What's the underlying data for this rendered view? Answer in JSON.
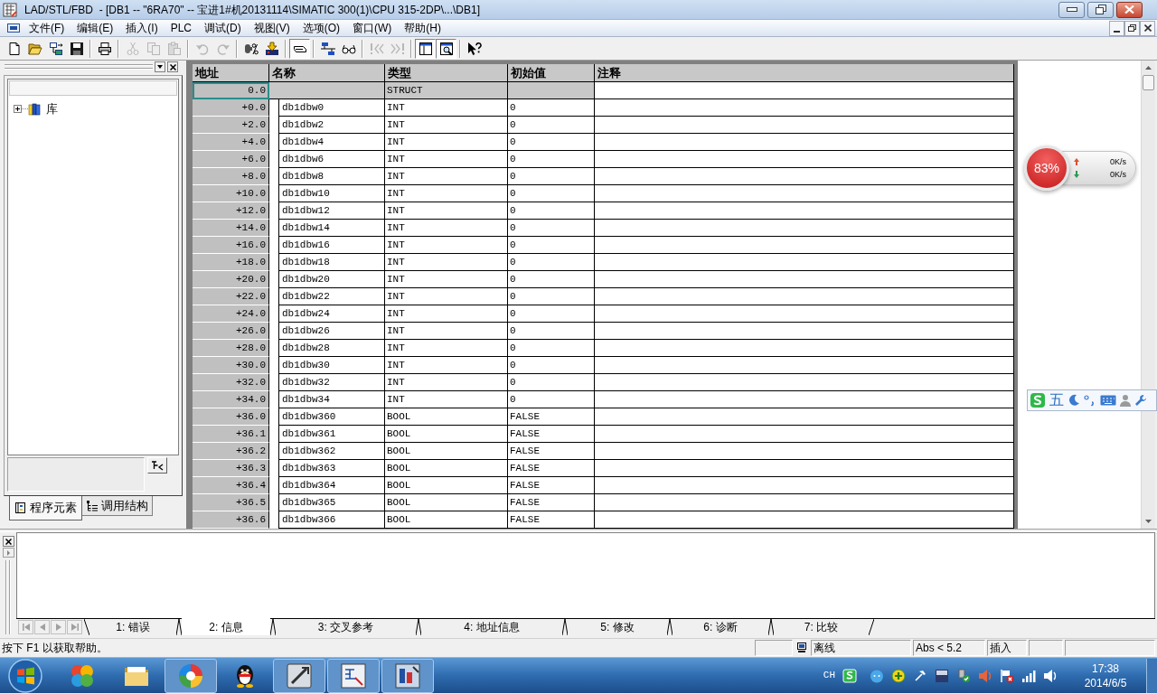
{
  "window": {
    "title": "LAD/STL/FBD  - [DB1 -- \"6RA70\" -- 宝进1#机20131114\\SIMATIC 300(1)\\CPU 315-2DP\\...\\DB1]"
  },
  "menu_bar": {
    "items": [
      "文件(F)",
      "编辑(E)",
      "插入(I)",
      "PLC",
      "调试(D)",
      "视图(V)",
      "选项(O)",
      "窗口(W)",
      "帮助(H)"
    ]
  },
  "toolbar": {
    "groups": [
      [
        {
          "kind": "new",
          "disabled": false,
          "pressed": false
        },
        {
          "kind": "open",
          "disabled": false,
          "pressed": false
        },
        {
          "kind": "nodes",
          "disabled": false,
          "pressed": false
        },
        {
          "kind": "save",
          "disabled": false,
          "pressed": false
        }
      ],
      [
        {
          "kind": "print",
          "disabled": false,
          "pressed": false
        }
      ],
      [
        {
          "kind": "cut",
          "disabled": true,
          "pressed": false
        },
        {
          "kind": "copy",
          "disabled": true,
          "pressed": false
        },
        {
          "kind": "paste",
          "disabled": true,
          "pressed": false
        }
      ],
      [
        {
          "kind": "undo",
          "disabled": true,
          "pressed": false
        },
        {
          "kind": "redo",
          "disabled": true,
          "pressed": false
        }
      ],
      [
        {
          "kind": "compile",
          "disabled": false,
          "pressed": false
        },
        {
          "kind": "download",
          "disabled": false,
          "pressed": false
        }
      ],
      [
        {
          "kind": "overview",
          "disabled": false,
          "pressed": true
        }
      ],
      [
        {
          "kind": "online",
          "disabled": false,
          "pressed": false
        },
        {
          "kind": "monitor",
          "disabled": false,
          "pressed": false
        }
      ],
      [
        {
          "kind": "previous",
          "disabled": true,
          "pressed": false
        },
        {
          "kind": "next",
          "disabled": true,
          "pressed": false
        }
      ],
      [
        {
          "kind": "panes",
          "disabled": false,
          "pressed": true
        },
        {
          "kind": "details",
          "disabled": false,
          "pressed": true
        }
      ],
      [
        {
          "kind": "help",
          "disabled": false,
          "pressed": false
        }
      ]
    ]
  },
  "program_elements": {
    "tree": [
      {
        "label": "库",
        "expanded": false
      }
    ],
    "tabs": [
      {
        "label": "程序元素",
        "selected": true
      },
      {
        "label": "调用结构",
        "selected": false
      }
    ]
  },
  "table": {
    "columns": [
      "地址",
      "名称",
      "类型",
      "初始值",
      "注释"
    ],
    "rows": [
      {
        "kind": "struct",
        "address": "0.0",
        "type": "STRUCT",
        "selected": true
      },
      {
        "kind": "element",
        "address": "+0.0",
        "name": "db1dbw0",
        "type": "INT",
        "initial_value": "0",
        "selected": false
      },
      {
        "kind": "element",
        "address": "+2.0",
        "name": "db1dbw2",
        "type": "INT",
        "initial_value": "0",
        "selected": false
      },
      {
        "kind": "element",
        "address": "+4.0",
        "name": "db1dbw4",
        "type": "INT",
        "initial_value": "0",
        "selected": false
      },
      {
        "kind": "element",
        "address": "+6.0",
        "name": "db1dbw6",
        "type": "INT",
        "initial_value": "0",
        "selected": false
      },
      {
        "kind": "element",
        "address": "+8.0",
        "name": "db1dbw8",
        "type": "INT",
        "initial_value": "0",
        "selected": false
      },
      {
        "kind": "element",
        "address": "+10.0",
        "name": "db1dbw10",
        "type": "INT",
        "initial_value": "0",
        "selected": false
      },
      {
        "kind": "element",
        "address": "+12.0",
        "name": "db1dbw12",
        "type": "INT",
        "initial_value": "0",
        "selected": false
      },
      {
        "kind": "element",
        "address": "+14.0",
        "name": "db1dbw14",
        "type": "INT",
        "initial_value": "0",
        "selected": false
      },
      {
        "kind": "element",
        "address": "+16.0",
        "name": "db1dbw16",
        "type": "INT",
        "initial_value": "0",
        "selected": false
      },
      {
        "kind": "element",
        "address": "+18.0",
        "name": "db1dbw18",
        "type": "INT",
        "initial_value": "0",
        "selected": false
      },
      {
        "kind": "element",
        "address": "+20.0",
        "name": "db1dbw20",
        "type": "INT",
        "initial_value": "0",
        "selected": false
      },
      {
        "kind": "element",
        "address": "+22.0",
        "name": "db1dbw22",
        "type": "INT",
        "initial_value": "0",
        "selected": false
      },
      {
        "kind": "element",
        "address": "+24.0",
        "name": "db1dbw24",
        "type": "INT",
        "initial_value": "0",
        "selected": false
      },
      {
        "kind": "element",
        "address": "+26.0",
        "name": "db1dbw26",
        "type": "INT",
        "initial_value": "0",
        "selected": false
      },
      {
        "kind": "element",
        "address": "+28.0",
        "name": "db1dbw28",
        "type": "INT",
        "initial_value": "0",
        "selected": false
      },
      {
        "kind": "element",
        "address": "+30.0",
        "name": "db1dbw30",
        "type": "INT",
        "initial_value": "0",
        "selected": false
      },
      {
        "kind": "element",
        "address": "+32.0",
        "name": "db1dbw32",
        "type": "INT",
        "initial_value": "0",
        "selected": false
      },
      {
        "kind": "element",
        "address": "+34.0",
        "name": "db1dbw34",
        "type": "INT",
        "initial_value": "0",
        "selected": false
      },
      {
        "kind": "element",
        "address": "+36.0",
        "name": "db1dbw360",
        "type": "BOOL",
        "initial_value": "FALSE",
        "selected": false
      },
      {
        "kind": "element",
        "address": "+36.1",
        "name": "db1dbw361",
        "type": "BOOL",
        "initial_value": "FALSE",
        "selected": false
      },
      {
        "kind": "element",
        "address": "+36.2",
        "name": "db1dbw362",
        "type": "BOOL",
        "initial_value": "FALSE",
        "selected": false
      },
      {
        "kind": "element",
        "address": "+36.3",
        "name": "db1dbw363",
        "type": "BOOL",
        "initial_value": "FALSE",
        "selected": false
      },
      {
        "kind": "element",
        "address": "+36.4",
        "name": "db1dbw364",
        "type": "BOOL",
        "initial_value": "FALSE",
        "selected": false
      },
      {
        "kind": "element",
        "address": "+36.5",
        "name": "db1dbw365",
        "type": "BOOL",
        "initial_value": "FALSE",
        "selected": false
      },
      {
        "kind": "element",
        "address": "+36.6",
        "name": "db1dbw366",
        "type": "BOOL",
        "initial_value": "FALSE",
        "selected": false
      }
    ]
  },
  "net_monitor": {
    "usage": "83%",
    "upload": "0K/s",
    "download": "0K/s"
  },
  "ime_bar": {
    "mode": "五"
  },
  "output_panel": {
    "tabs": [
      {
        "label": "1: 错误",
        "selected": false
      },
      {
        "label": "2: 信息",
        "selected": true
      },
      {
        "label": "3: 交叉参考",
        "selected": false
      },
      {
        "label": "4: 地址信息",
        "selected": false
      },
      {
        "label": "5: 修改",
        "selected": false
      },
      {
        "label": "6: 诊断",
        "selected": false
      },
      {
        "label": "7: 比较",
        "selected": false
      }
    ]
  },
  "status_bar": {
    "message": "按下 F1 以获取帮助。",
    "connection": "离线",
    "address_mode": "Abs < 5.2",
    "edit_mode": "插入"
  },
  "taskbar": {
    "apps": [
      {
        "kind": "pinwheel",
        "running": false
      },
      {
        "kind": "folder",
        "running": false
      },
      {
        "kind": "wheel",
        "running": true
      },
      {
        "kind": "penguin",
        "running": false
      },
      {
        "kind": "pencil",
        "running": true
      },
      {
        "kind": "diagram",
        "running": true
      },
      {
        "kind": "chart",
        "running": true
      }
    ],
    "tray": {
      "language": "CH",
      "time": "17:38",
      "date": "2014/6/5"
    }
  }
}
